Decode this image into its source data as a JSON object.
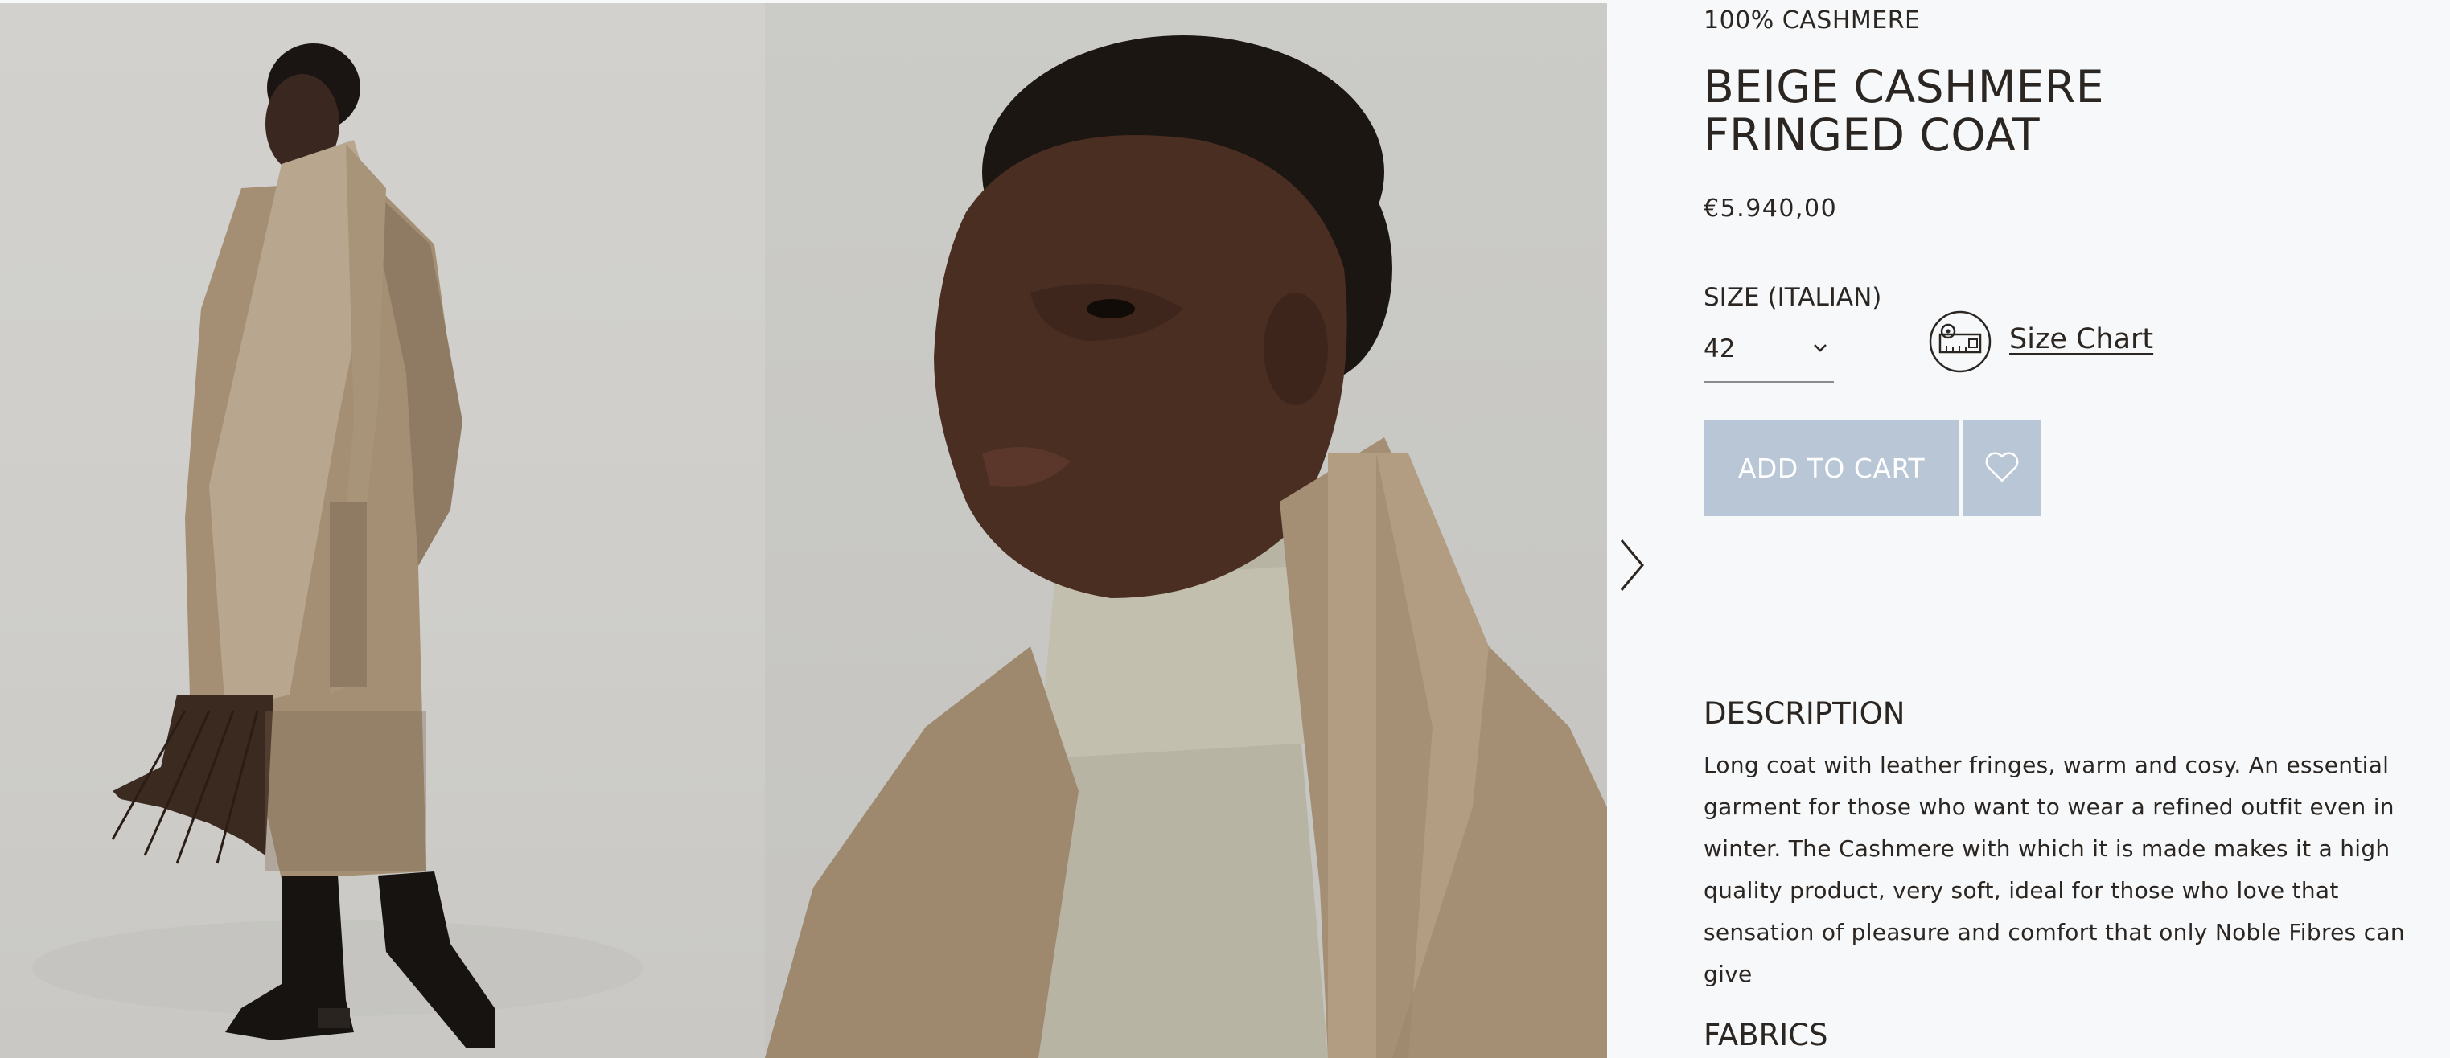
{
  "gallery": {
    "image1_alt": "Full length view of model wearing beige cashmere fringed coat",
    "image2_alt": "Close up of model wearing beige cashmere fringed coat",
    "next_icon": "chevron-right-icon"
  },
  "product": {
    "collection": "100% CASHMERE",
    "title": "BEIGE CASHMERE FRINGED COAT",
    "price": "€5.940,00"
  },
  "size": {
    "label": "SIZE (ITALIAN)",
    "selected": "42",
    "chart_link": "Size Chart",
    "chart_icon": "measuring-tape-icon"
  },
  "actions": {
    "add_to_cart": "ADD TO CART",
    "wishlist_icon": "heart-icon"
  },
  "description": {
    "heading": "DESCRIPTION",
    "text": "Long coat with leather fringes, warm and cosy. An essential garment for those who want to wear a refined outfit even in winter. The Cashmere with which it is made makes it a high quality product, very soft, ideal for those who love that sensation of pleasure and comfort that only Noble Fibres can give"
  },
  "fabrics": {
    "heading": "FABRICS"
  },
  "colors": {
    "background": "#f6f8fa",
    "text": "#2b2622",
    "button": "#b8c6d6",
    "button_text": "#ffffff"
  }
}
